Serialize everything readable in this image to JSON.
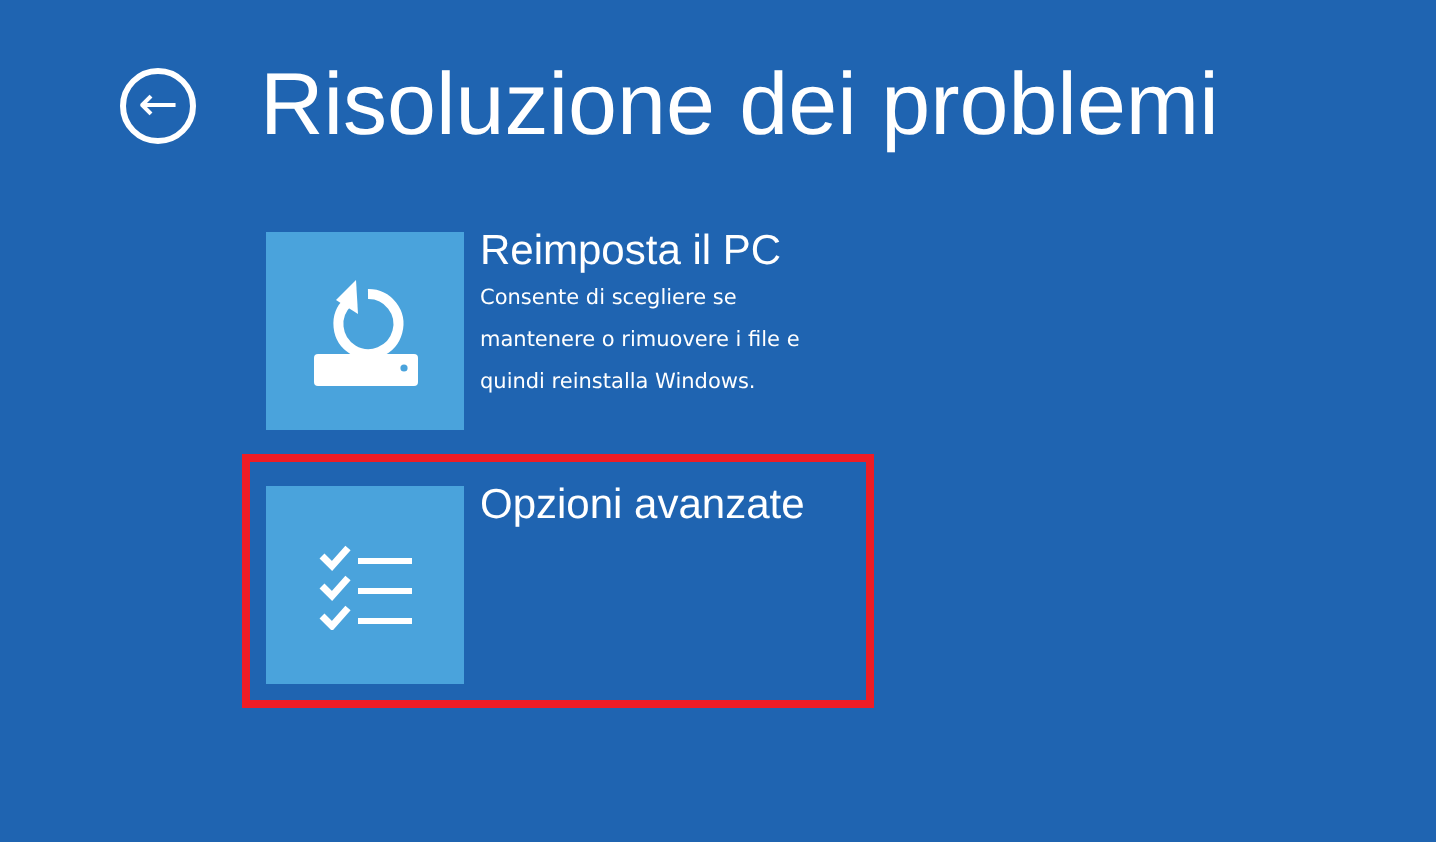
{
  "header": {
    "back_button": "←",
    "title": "Risoluzione dei problemi"
  },
  "options": [
    {
      "kind": "reset",
      "title": "Reimposta il PC",
      "description": "Consente di scegliere se mantenere o rimuovere i file e quindi reinstalla Windows.",
      "highlighted": false
    },
    {
      "kind": "advanced",
      "title": "Opzioni avanzate",
      "highlighted": true
    }
  ]
}
